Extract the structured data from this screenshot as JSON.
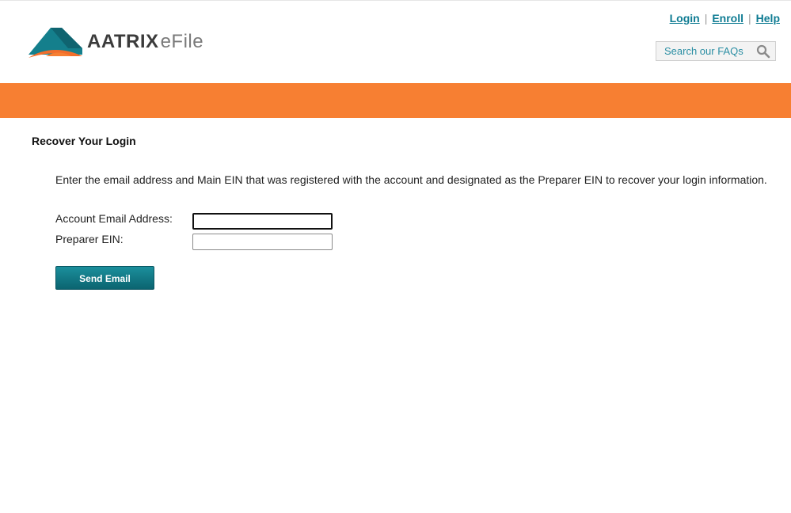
{
  "brand": {
    "name": "AATRIX",
    "product": "eFile",
    "colors": {
      "teal": "#147f8c",
      "orange": "#f77f32",
      "text": "#3b3b3b"
    }
  },
  "header": {
    "links": [
      {
        "label": "Login"
      },
      {
        "label": "Enroll"
      },
      {
        "label": "Help"
      }
    ],
    "separator": "|",
    "faq_search": {
      "placeholder": "Search our FAQs",
      "value": "",
      "icon": "search-icon"
    }
  },
  "banner": {
    "color": "#f77f32"
  },
  "main": {
    "title": "Recover Your Login",
    "intro": "Enter the email address and Main EIN that was registered with the account and designated as the Preparer EIN to recover your login information.",
    "fields": [
      {
        "label": "Account Email Address:",
        "value": ""
      },
      {
        "label": "Preparer EIN:",
        "value": ""
      }
    ],
    "submit_label": "Send Email"
  }
}
